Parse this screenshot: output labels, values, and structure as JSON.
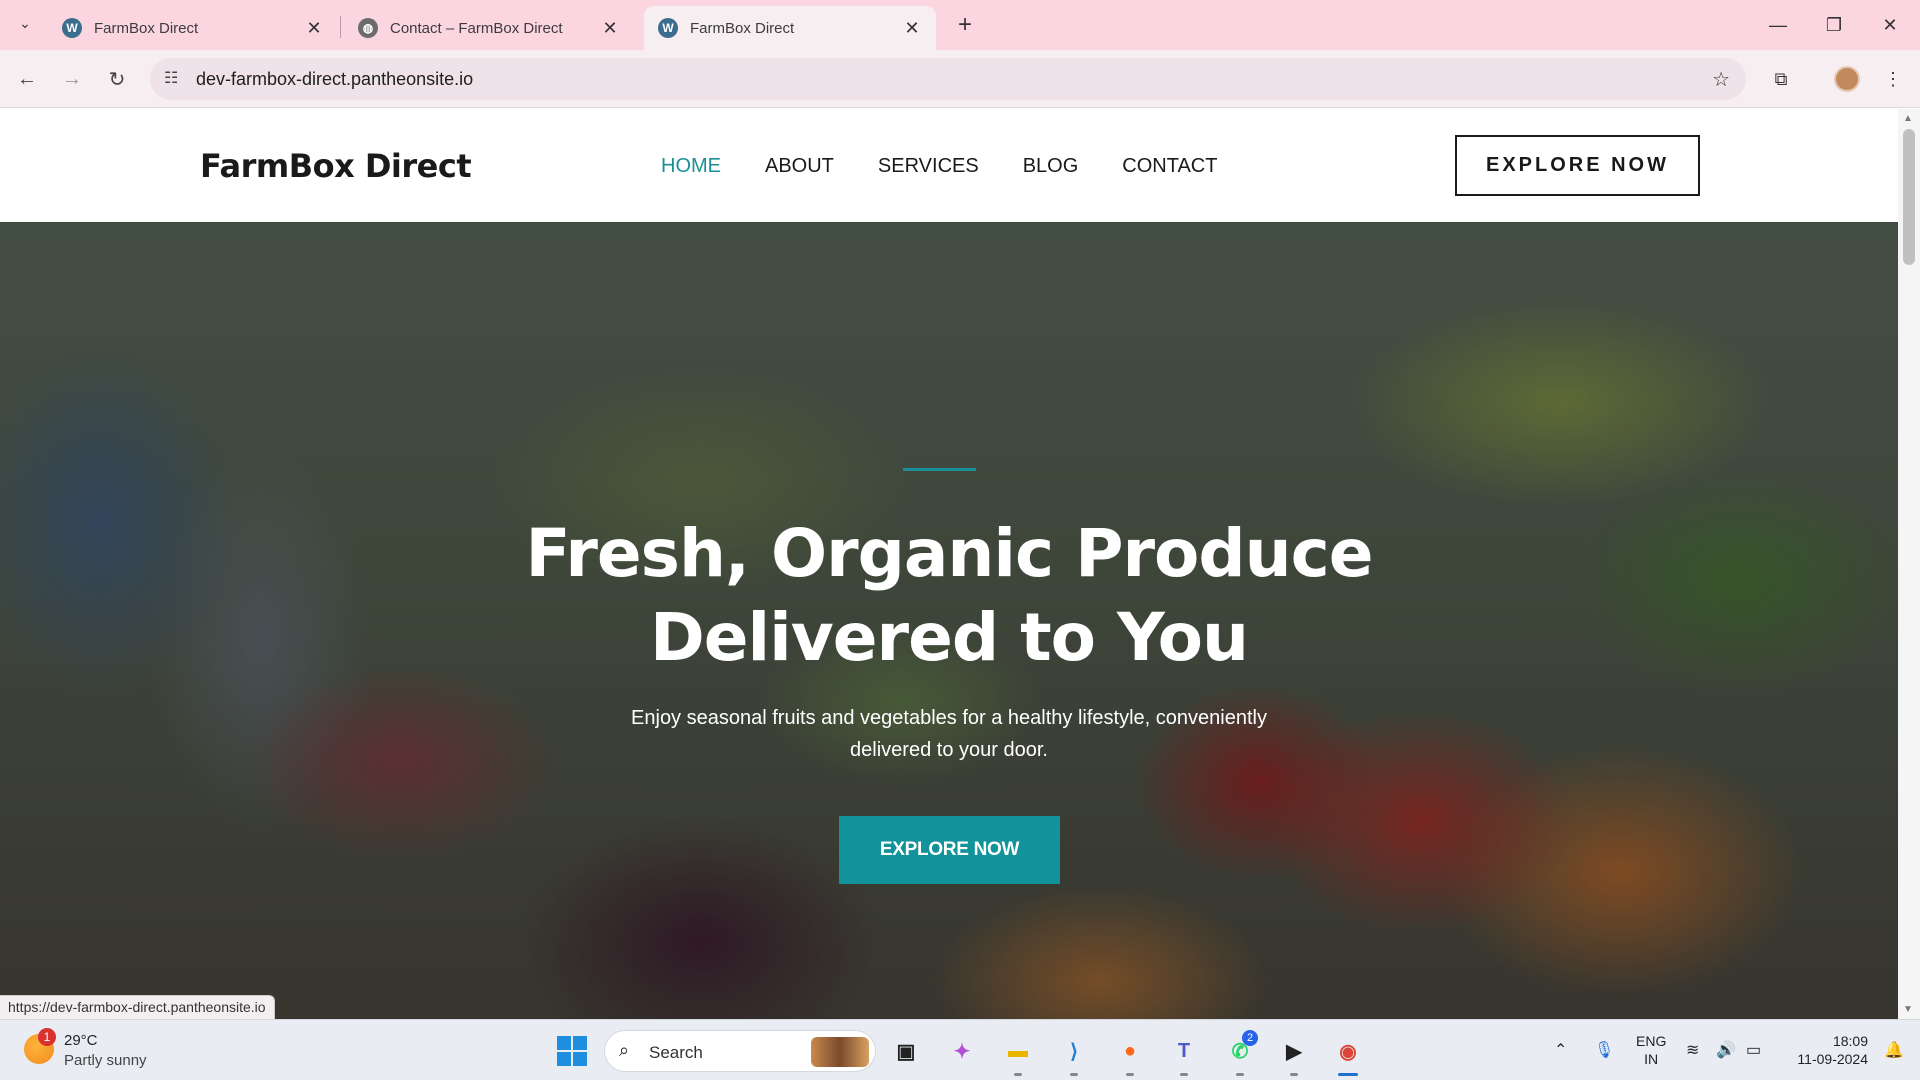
{
  "browser": {
    "tabs": [
      {
        "title": "FarmBox Direct",
        "icon": "wordpress-icon",
        "active": false
      },
      {
        "title": "Contact – FarmBox Direct",
        "icon": "globe-icon",
        "active": false
      },
      {
        "title": "FarmBox Direct",
        "icon": "wordpress-icon",
        "active": true
      }
    ],
    "url": "dev-farmbox-direct.pantheonsite.io",
    "status_url": "https://dev-farmbox-direct.pantheonsite.io"
  },
  "site": {
    "logo": "FarmBox Direct",
    "nav": [
      {
        "label": "HOME",
        "active": true
      },
      {
        "label": "ABOUT",
        "active": false
      },
      {
        "label": "SERVICES",
        "active": false
      },
      {
        "label": "BLOG",
        "active": false
      },
      {
        "label": "CONTACT",
        "active": false
      }
    ],
    "header_button": "EXPLORE NOW",
    "accent_color": "#12939b"
  },
  "hero": {
    "title": "Fresh, Organic Produce Delivered to You",
    "subtitle": "Enjoy seasonal fruits and vegetables for a healthy lifestyle, conveniently delivered to your door.",
    "button": "EXPLORE NOW"
  },
  "taskbar": {
    "weather_temp": "29°C",
    "weather_condition": "Partly sunny",
    "weather_badge": "1",
    "search_label": "Search",
    "teams_badge": "2",
    "lang_line1": "ENG",
    "lang_line2": "IN",
    "time": "18:09",
    "date": "11-09-2024"
  }
}
